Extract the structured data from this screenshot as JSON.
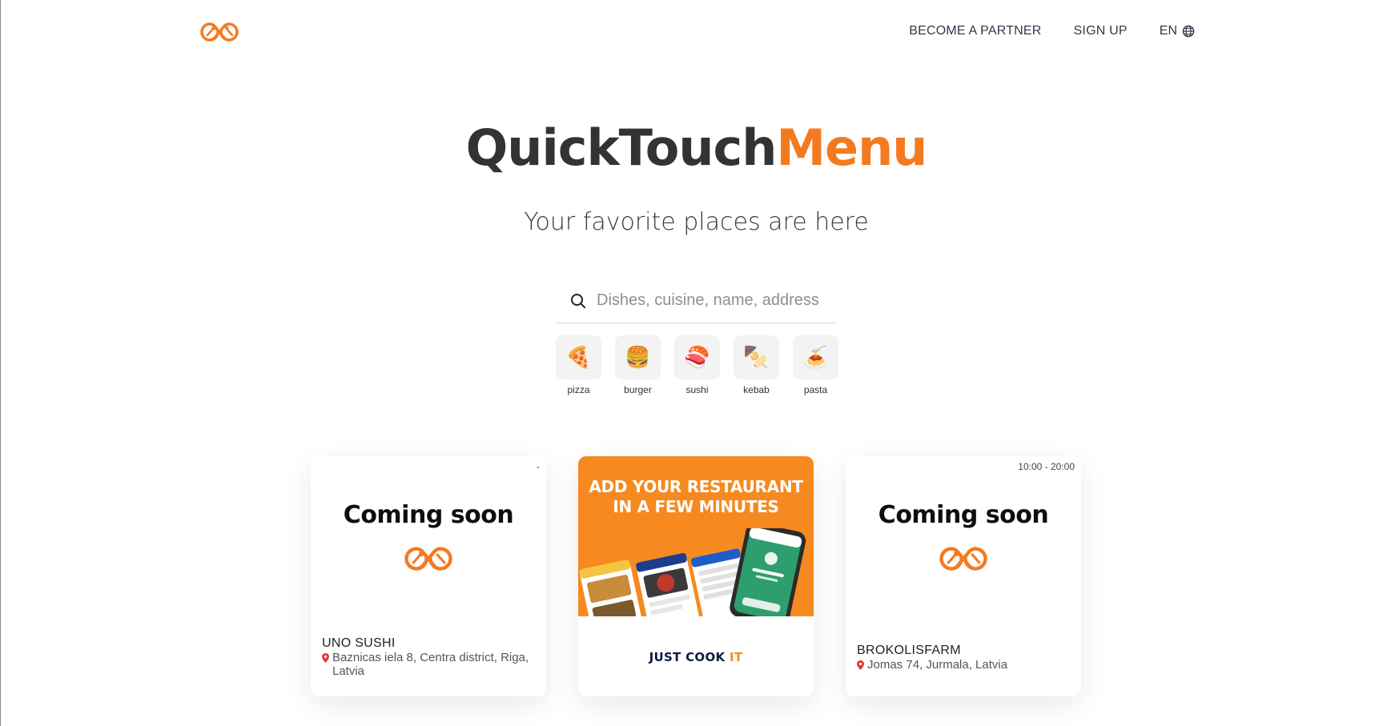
{
  "header": {
    "nav": {
      "become_partner": "BECOME A PARTNER",
      "sign_up": "SIGN UP",
      "language": "EN"
    }
  },
  "hero": {
    "title_part1": "QuickTouch",
    "title_part2": "Menu",
    "subtitle": "Your favorite places are here"
  },
  "search": {
    "placeholder": "Dishes, cuisine, name, address",
    "value": ""
  },
  "categories": [
    {
      "label": "pizza",
      "emoji": "🍕"
    },
    {
      "label": "burger",
      "emoji": "🍔"
    },
    {
      "label": "sushi",
      "emoji": "🍣"
    },
    {
      "label": "kebab",
      "emoji": "🍢"
    },
    {
      "label": "pasta",
      "emoji": "🍝"
    }
  ],
  "cards": [
    {
      "hours": "-",
      "badge": "Coming soon",
      "name": "UNO SUSHI",
      "address": "Baznicas iela 8, Centra district, Riga, Latvia"
    },
    {
      "promo_line1": "ADD YOUR RESTAURANT",
      "promo_line2": "IN A FEW MINUTES",
      "cta_part1": "JUST COOK ",
      "cta_part2": "IT"
    },
    {
      "hours": "10:00 - 20:00",
      "badge": "Coming soon",
      "name": "BROKOLISFARM",
      "address": "Jomas 74, Jurmala, Latvia"
    }
  ],
  "colors": {
    "brand_orange": "#f47a1f",
    "promo_orange": "#f6891f",
    "dark_text": "#333333",
    "pin_red": "#e53935"
  },
  "icons": {
    "logo": "infinity-spoon-fork-logo",
    "search": "search-icon",
    "globe": "globe-icon",
    "pin": "map-pin-icon"
  }
}
